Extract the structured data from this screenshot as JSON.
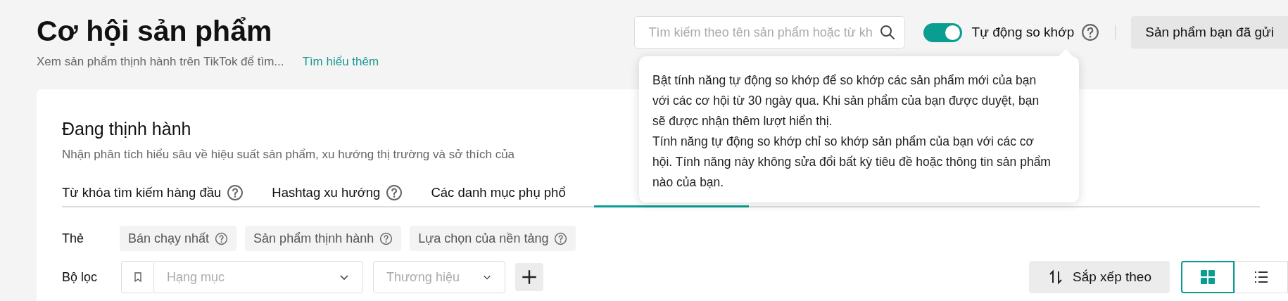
{
  "header": {
    "title": "Cơ hội sản phẩm",
    "subtitle": "Xem sản phẩm thịnh hành trên TikTok để tìm...",
    "learn_more": "Tìm hiểu thêm"
  },
  "search": {
    "placeholder": "Tìm kiếm theo tên sản phẩm hoặc từ kh"
  },
  "auto_match": {
    "label": "Tự động so khớp",
    "on": true
  },
  "submitted_button": "Sản phẩm bạn đã gửi",
  "tooltip": {
    "paragraphs": [
      "Bật tính năng tự động so khớp để so khớp các sản phẩm mới của bạn với các cơ hội từ 30 ngày qua. Khi sản phẩm của bạn được duyệt, bạn sẽ được nhận thêm lượt hiển thị.",
      "Tính năng tự động so khớp chỉ so khớp sản phẩm của bạn với các cơ hội. Tính năng này không sửa đổi bất kỳ tiêu đề hoặc thông tin sản phẩm nào của bạn."
    ]
  },
  "section": {
    "title": "Đang thịnh hành",
    "description": "Nhận phân tích hiểu sâu về hiệu suất sản phẩm, xu hướng thị trường và sở thích của"
  },
  "tabs": [
    {
      "label": "Từ khóa tìm kiếm hàng đầu",
      "selected": false
    },
    {
      "label": "Hashtag xu hướng",
      "selected": false
    },
    {
      "label": "Các danh mục phụ phổ",
      "selected": false
    },
    {
      "selected": true
    }
  ],
  "tags": {
    "label": "Thẻ",
    "items": [
      "Bán chạy nhất",
      "Sản phẩm thịnh hành",
      "Lựa chọn của nền tảng"
    ]
  },
  "filters": {
    "label": "Bộ lọc",
    "category_placeholder": "Hạng mục",
    "brand_placeholder": "Thương hiệu"
  },
  "sort_button": "Sắp xếp theo",
  "view_modes": [
    {
      "kind": "grid",
      "selected": true
    },
    {
      "kind": "list",
      "selected": false
    }
  ]
}
